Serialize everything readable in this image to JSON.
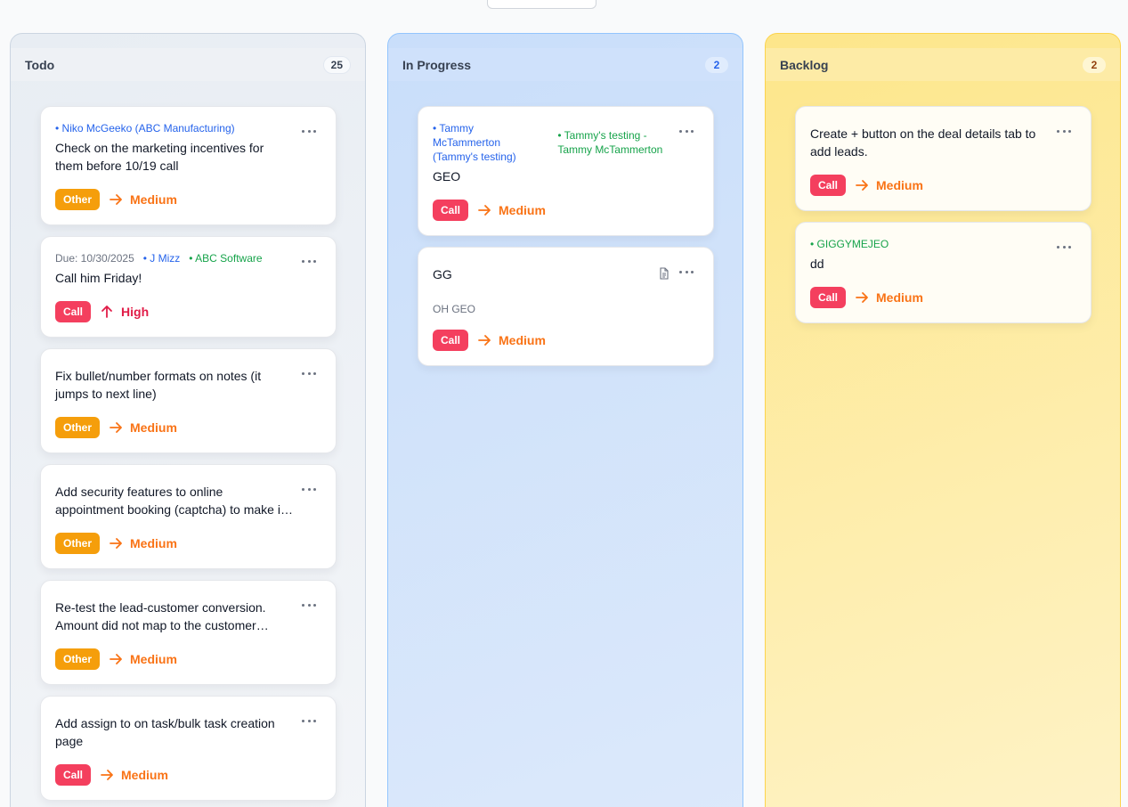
{
  "columns": {
    "todo": {
      "title": "Todo",
      "count": "25",
      "cards": [
        {
          "contact": "Niko McGeeko (ABC Manufacturing)",
          "title": "Check on the marketing incentives for them before 10/19 call",
          "tag": "Other",
          "priority": "Medium"
        },
        {
          "due": "Due: 10/30/2025",
          "contact": "J Mizz",
          "company": "ABC Software",
          "title": "Call him Friday!",
          "tag": "Call",
          "priority": "High"
        },
        {
          "title": "Fix bullet/number formats on notes (it jumps to next line)",
          "tag": "Other",
          "priority": "Medium"
        },
        {
          "title": "Add security features to online appointment booking (captcha) to make it more secure",
          "tag": "Other",
          "priority": "Medium"
        },
        {
          "title": "Re-test the lead-customer conversion. Amount did not map to the customer opportunity",
          "tag": "Other",
          "priority": "Medium"
        },
        {
          "title": "Add assign to on task/bulk task creation page",
          "tag": "Call",
          "priority": "Medium"
        }
      ]
    },
    "in_progress": {
      "title": "In Progress",
      "count": "2",
      "cards": [
        {
          "contact": "Tammy McTammerton (Tammy's testing)",
          "company": "Tammy's testing - Tammy McTammerton",
          "title": "GEO",
          "tag": "Call",
          "priority": "Medium"
        },
        {
          "title": "GG",
          "subtitle": "OH GEO",
          "tag": "Call",
          "priority": "Medium"
        }
      ]
    },
    "backlog": {
      "title": "Backlog",
      "count": "2",
      "cards": [
        {
          "title": "Create + button on the deal details tab to add leads.",
          "tag": "Call",
          "priority": "Medium"
        },
        {
          "company": "GIGGYMEJEO",
          "title": "dd",
          "tag": "Call",
          "priority": "Medium"
        }
      ]
    }
  },
  "icons": {
    "menu": "more-horizontal-icon",
    "note": "document-icon",
    "medium": "arrow-right-icon",
    "high": "arrow-up-icon"
  },
  "colors": {
    "tag_other": "#f59e0b",
    "tag_call": "#f43f5e",
    "priority_medium": "#f97316",
    "priority_high": "#e11d48",
    "contact": "#2563eb",
    "company": "#16a34a"
  }
}
